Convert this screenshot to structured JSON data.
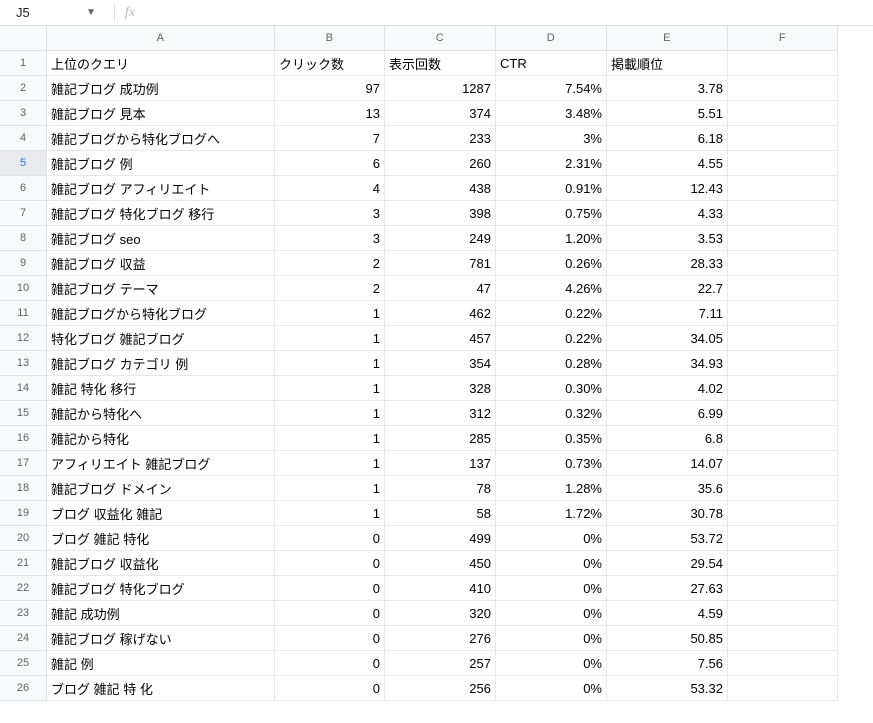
{
  "formula_bar": {
    "cell_ref": "J5",
    "fx_label": "fx"
  },
  "columns": [
    {
      "letter": "A",
      "class": "col-A"
    },
    {
      "letter": "B",
      "class": "col-B"
    },
    {
      "letter": "C",
      "class": "col-C"
    },
    {
      "letter": "D",
      "class": "col-D"
    },
    {
      "letter": "E",
      "class": "col-E"
    },
    {
      "letter": "F",
      "class": "col-F"
    }
  ],
  "selected_row": 5,
  "headers": {
    "A": "上位のクエリ",
    "B": "クリック数",
    "C": "表示回数",
    "D": "CTR",
    "E": "掲載順位"
  },
  "rows": [
    {
      "n": 1,
      "A": "上位のクエリ",
      "B": "クリック数",
      "C": "表示回数",
      "D": "CTR",
      "E": "掲載順位",
      "header": true
    },
    {
      "n": 2,
      "A": "雑記ブログ 成功例",
      "B": "97",
      "C": "1287",
      "D": "7.54%",
      "E": "3.78"
    },
    {
      "n": 3,
      "A": "雑記ブログ 見本",
      "B": "13",
      "C": "374",
      "D": "3.48%",
      "E": "5.51"
    },
    {
      "n": 4,
      "A": "雑記ブログから特化ブログへ",
      "B": "7",
      "C": "233",
      "D": "3%",
      "E": "6.18"
    },
    {
      "n": 5,
      "A": "雑記ブログ 例",
      "B": "6",
      "C": "260",
      "D": "2.31%",
      "E": "4.55"
    },
    {
      "n": 6,
      "A": "雑記ブログ アフィリエイト",
      "B": "4",
      "C": "438",
      "D": "0.91%",
      "E": "12.43"
    },
    {
      "n": 7,
      "A": "雑記ブログ 特化ブログ 移行",
      "B": "3",
      "C": "398",
      "D": "0.75%",
      "E": "4.33"
    },
    {
      "n": 8,
      "A": "雑記ブログ seo",
      "B": "3",
      "C": "249",
      "D": "1.20%",
      "E": "3.53"
    },
    {
      "n": 9,
      "A": "雑記ブログ 収益",
      "B": "2",
      "C": "781",
      "D": "0.26%",
      "E": "28.33"
    },
    {
      "n": 10,
      "A": "雑記ブログ テーマ",
      "B": "2",
      "C": "47",
      "D": "4.26%",
      "E": "22.7"
    },
    {
      "n": 11,
      "A": "雑記ブログから特化ブログ",
      "B": "1",
      "C": "462",
      "D": "0.22%",
      "E": "7.11"
    },
    {
      "n": 12,
      "A": "特化ブログ 雑記ブログ",
      "B": "1",
      "C": "457",
      "D": "0.22%",
      "E": "34.05"
    },
    {
      "n": 13,
      "A": "雑記ブログ カテゴリ 例",
      "B": "1",
      "C": "354",
      "D": "0.28%",
      "E": "34.93"
    },
    {
      "n": 14,
      "A": "雑記 特化 移行",
      "B": "1",
      "C": "328",
      "D": "0.30%",
      "E": "4.02"
    },
    {
      "n": 15,
      "A": "雑記から特化へ",
      "B": "1",
      "C": "312",
      "D": "0.32%",
      "E": "6.99"
    },
    {
      "n": 16,
      "A": "雑記から特化",
      "B": "1",
      "C": "285",
      "D": "0.35%",
      "E": "6.8"
    },
    {
      "n": 17,
      "A": "アフィリエイト 雑記ブログ",
      "B": "1",
      "C": "137",
      "D": "0.73%",
      "E": "14.07"
    },
    {
      "n": 18,
      "A": "雑記ブログ ドメイン",
      "B": "1",
      "C": "78",
      "D": "1.28%",
      "E": "35.6"
    },
    {
      "n": 19,
      "A": "ブログ 収益化 雑記",
      "B": "1",
      "C": "58",
      "D": "1.72%",
      "E": "30.78"
    },
    {
      "n": 20,
      "A": "ブログ 雑記 特化",
      "B": "0",
      "C": "499",
      "D": "0%",
      "E": "53.72"
    },
    {
      "n": 21,
      "A": "雑記ブログ 収益化",
      "B": "0",
      "C": "450",
      "D": "0%",
      "E": "29.54"
    },
    {
      "n": 22,
      "A": "雑記ブログ 特化ブログ",
      "B": "0",
      "C": "410",
      "D": "0%",
      "E": "27.63"
    },
    {
      "n": 23,
      "A": "雑記 成功例",
      "B": "0",
      "C": "320",
      "D": "0%",
      "E": "4.59"
    },
    {
      "n": 24,
      "A": "雑記ブログ 稼げない",
      "B": "0",
      "C": "276",
      "D": "0%",
      "E": "50.85"
    },
    {
      "n": 25,
      "A": "雑記 例",
      "B": "0",
      "C": "257",
      "D": "0%",
      "E": "7.56"
    },
    {
      "n": 26,
      "A": "ブログ 雑記 特 化",
      "B": "0",
      "C": "256",
      "D": "0%",
      "E": "53.32"
    }
  ]
}
